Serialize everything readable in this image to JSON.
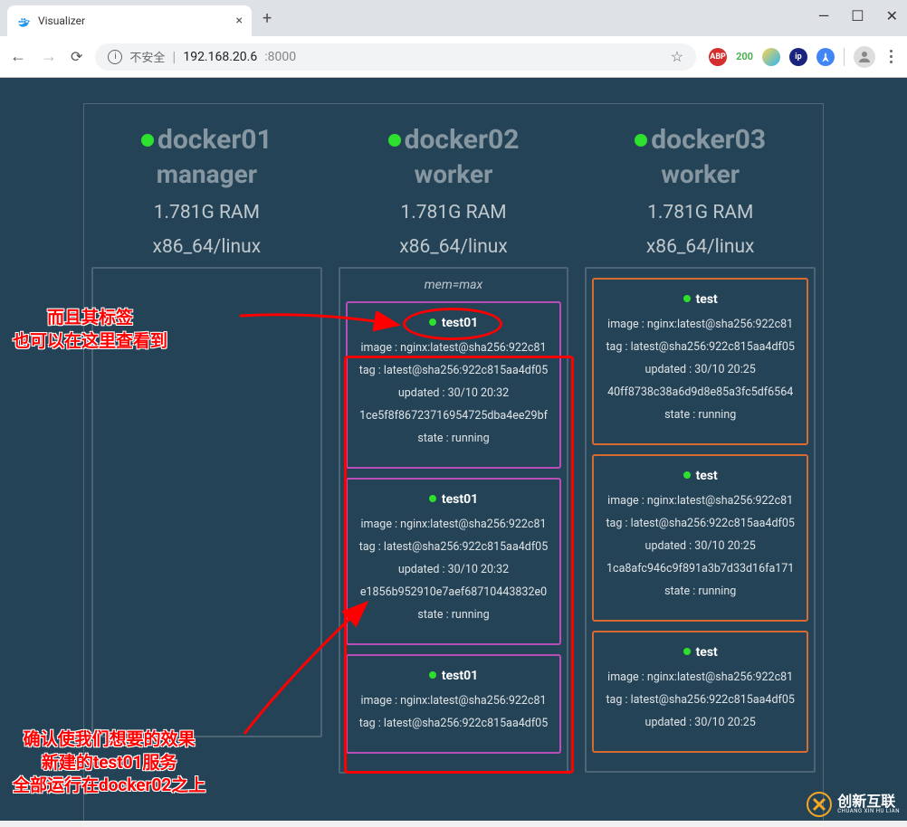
{
  "browser": {
    "tab_title": "Visualizer",
    "security_label": "不安全",
    "url_host": "192.168.20.6",
    "url_port": ":8000",
    "ext_abp": "ABP",
    "ext_200": "200"
  },
  "nodes": [
    {
      "name": "docker01",
      "role": "manager",
      "ram": "1.781G RAM",
      "arch": "x86_64/linux",
      "labels": [],
      "services": []
    },
    {
      "name": "docker02",
      "role": "worker",
      "ram": "1.781G RAM",
      "arch": "x86_64/linux",
      "labels": [
        "mem=max"
      ],
      "services": [
        {
          "name": "test01",
          "color": "purple",
          "lines": [
            "image : nginx:latest@sha256:922c81",
            "tag : latest@sha256:922c815aa4df05",
            "updated : 30/10 20:32",
            "1ce5f8f86723716954725dba4ee29bf",
            "state : running"
          ]
        },
        {
          "name": "test01",
          "color": "purple",
          "lines": [
            "image : nginx:latest@sha256:922c81",
            "tag : latest@sha256:922c815aa4df05",
            "updated : 30/10 20:32",
            "e1856b952910e7aef68710443832e0",
            "state : running"
          ]
        },
        {
          "name": "test01",
          "color": "purple",
          "lines": [
            "image : nginx:latest@sha256:922c81",
            "tag : latest@sha256:922c815aa4df05"
          ]
        }
      ]
    },
    {
      "name": "docker03",
      "role": "worker",
      "ram": "1.781G RAM",
      "arch": "x86_64/linux",
      "labels": [],
      "services": [
        {
          "name": "test",
          "color": "orange",
          "lines": [
            "image : nginx:latest@sha256:922c81",
            "tag : latest@sha256:922c815aa4df05",
            "updated : 30/10 20:25",
            "40ff8738c38a6d9d8e85a3fc5df6564",
            "state : running"
          ]
        },
        {
          "name": "test",
          "color": "orange",
          "lines": [
            "image : nginx:latest@sha256:922c81",
            "tag : latest@sha256:922c815aa4df05",
            "updated : 30/10 20:25",
            "1ca8afc946c9f891a3b7d33d16fa171",
            "state : running"
          ]
        },
        {
          "name": "test",
          "color": "orange",
          "lines": [
            "image : nginx:latest@sha256:922c81",
            "tag : latest@sha256:922c815aa4df05",
            "updated : 30/10 20:25"
          ]
        }
      ]
    }
  ],
  "annotations": {
    "top_line1": "而且其标签",
    "top_line2": "也可以在这里查看到",
    "bottom_line1": "确认使我们想要的效果",
    "bottom_line2": "新建的test01服务",
    "bottom_line3": "全部运行在docker02之上"
  },
  "watermark": {
    "cn": "创新互联",
    "en": "CHUANG XIN HU LIAN"
  }
}
